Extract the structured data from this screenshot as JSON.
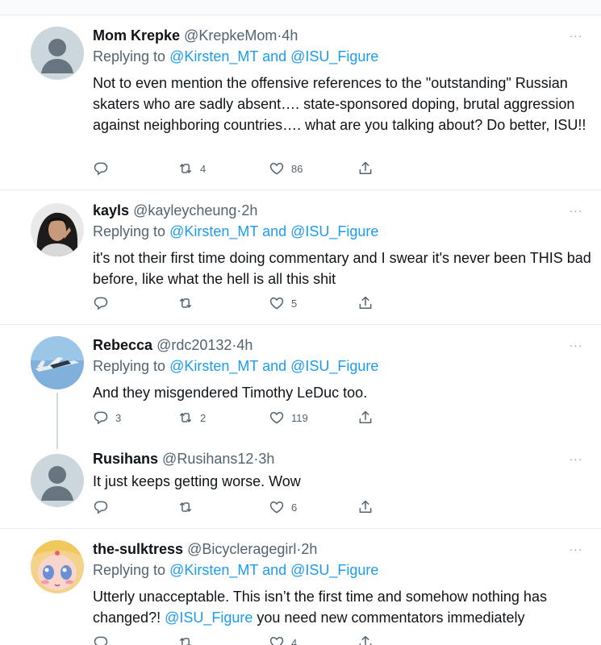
{
  "tweets": [
    {
      "name": "Mom Krepke",
      "handle": "@KrepkeMom",
      "separator": "·",
      "time": "4h",
      "replying_prefix": "Replying to",
      "replying_user1": "@Kirsten_MT",
      "replying_and": "and",
      "replying_user2": "@ISU_Figure",
      "text": "Not to even mention the offensive references to the \"outstanding\" Russian skaters who are sadly absent…. state-sponsored doping, brutal aggression against neighboring countries…. what are you talking about? Do better, ISU!!",
      "replies": "",
      "retweets": "4",
      "likes": "86",
      "avatar": "default-avatar-icon"
    },
    {
      "name": "kayls",
      "handle": "@kayleycheung",
      "separator": "·",
      "time": "2h",
      "replying_prefix": "Replying to",
      "replying_user1": "@Kirsten_MT",
      "replying_and": "and",
      "replying_user2": "@ISU_Figure",
      "text": "it's not their first time doing commentary and I swear it's never been THIS bad before, like what the hell is all this shit",
      "replies": "",
      "retweets": "",
      "likes": "5",
      "avatar": "photo-avatar"
    },
    {
      "name": "Rebecca",
      "handle": "@rdc20132",
      "separator": "·",
      "time": "4h",
      "replying_prefix": "Replying to",
      "replying_user1": "@Kirsten_MT",
      "replying_and": "and",
      "replying_user2": "@ISU_Figure",
      "text": "And they misgendered Timothy LeDuc too.",
      "replies": "3",
      "retweets": "2",
      "likes": "119",
      "avatar": "airplane-avatar"
    },
    {
      "name": "Rusihans",
      "handle": "@Rusihans12",
      "separator": "·",
      "time": "3h",
      "text": "It just keeps getting worse.  Wow",
      "replies": "",
      "retweets": "",
      "likes": "6",
      "avatar": "default-avatar-icon"
    },
    {
      "name": "the-sulktress",
      "handle": "@Bicycleragegirl",
      "separator": "·",
      "time": "2h",
      "replying_prefix": "Replying to",
      "replying_user1": "@Kirsten_MT",
      "replying_and": "and",
      "replying_user2": "@ISU_Figure",
      "text_part1": "Utterly unacceptable. This isn’t the first time and somehow nothing has changed?! ",
      "text_mention": "@ISU_Figure",
      "text_part2": " you need new commentators immediately",
      "replies": "",
      "retweets": "",
      "likes": "4",
      "avatar": "anime-avatar"
    }
  ],
  "more_glyph": "···",
  "colors": {
    "link": "#1d9bf0",
    "muted": "#536471",
    "divider": "#e6ecf0"
  }
}
